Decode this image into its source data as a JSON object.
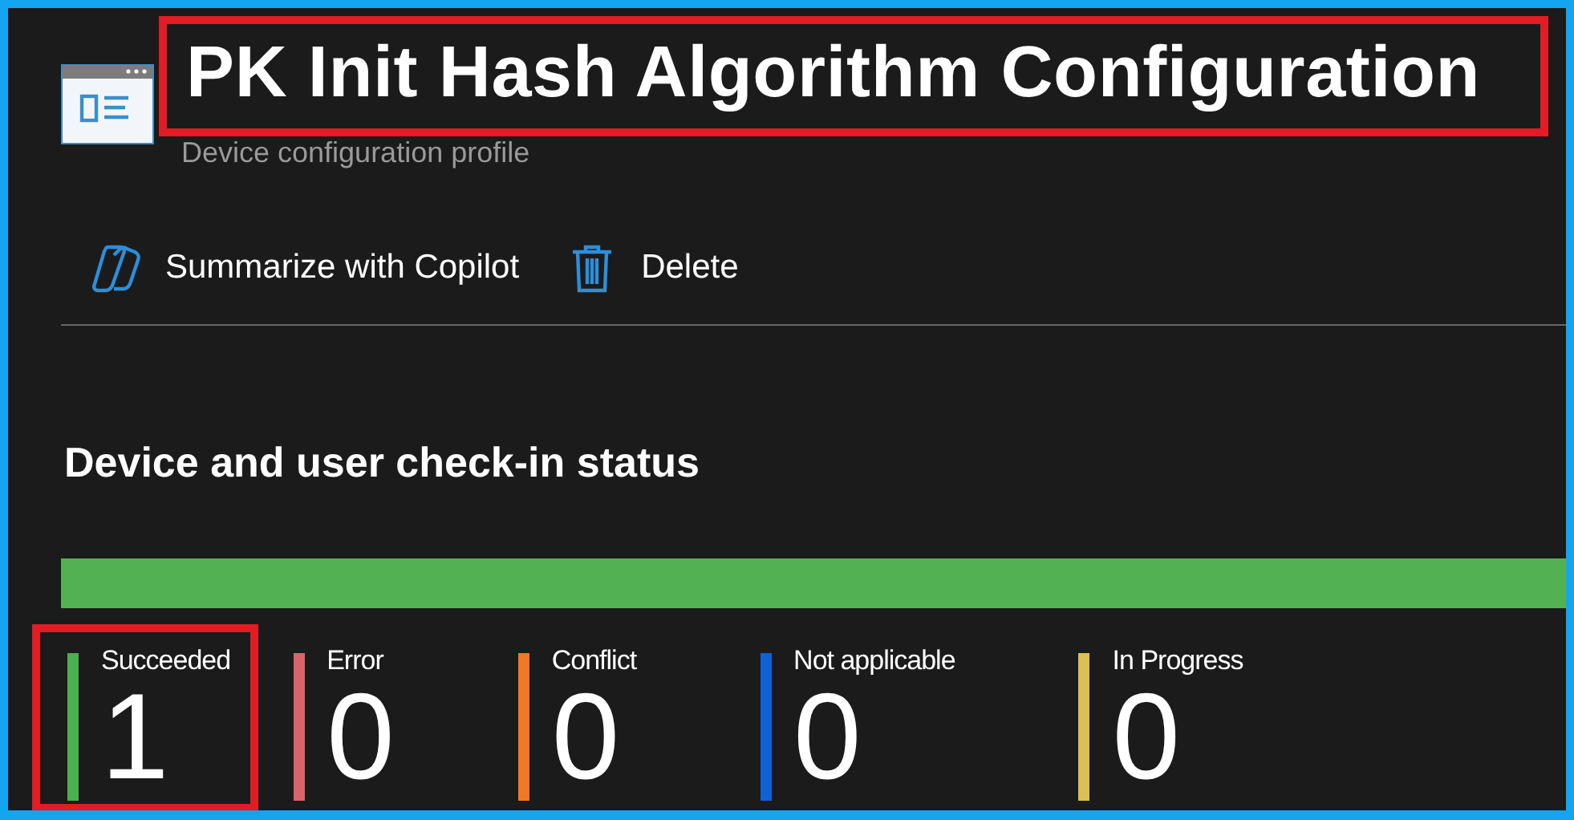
{
  "header": {
    "title": "PK Init Hash Algorithm Configuration",
    "title_highlighted": true,
    "subtitle": "Device configuration profile"
  },
  "toolbar": [
    {
      "label": "Summarize with Copilot",
      "kind": "copilot"
    },
    {
      "label": "Delete",
      "kind": "delete"
    }
  ],
  "status": {
    "heading": "Device and user check-in status",
    "level": 1,
    "stats": [
      {
        "label": "Succeeded",
        "count": "1",
        "color": "#4caf50",
        "highlighted": true
      },
      {
        "label": "Error",
        "count": "0",
        "color": "#d9646c",
        "highlighted": false
      },
      {
        "label": "Conflict",
        "count": "0",
        "color": "#f07826",
        "highlighted": false
      },
      {
        "label": "Not applicable",
        "count": "0",
        "color": "#1060d8",
        "highlighted": false
      },
      {
        "label": "In Progress",
        "count": "0",
        "color": "#dcbf55",
        "highlighted": false
      }
    ]
  }
}
